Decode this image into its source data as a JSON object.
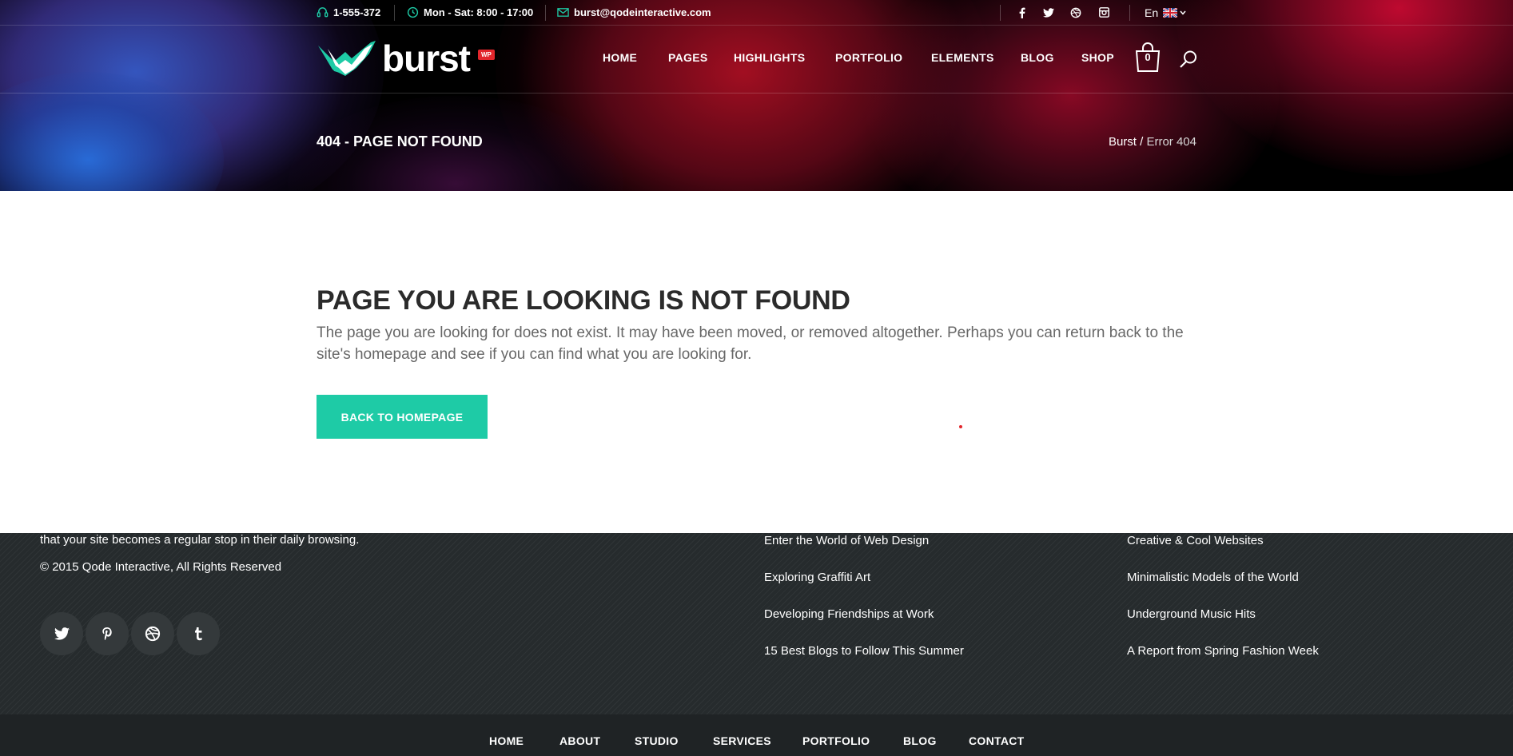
{
  "colors": {
    "accent": "#1ecba6",
    "badge": "#e2262c",
    "footer_bg": "#262b2d"
  },
  "topbar": {
    "phone": "1-555-372",
    "hours": "Mon - Sat: 8:00 - 17:00",
    "email": "burst@qodeinteractive.com",
    "language": "En",
    "social_icons": [
      "facebook-icon",
      "twitter-icon",
      "dribbble-icon",
      "instagram-icon"
    ]
  },
  "brand": {
    "name": "burst",
    "badge": "WP"
  },
  "nav": {
    "items": [
      "HOME",
      "PAGES",
      "HIGHLIGHTS",
      "PORTFOLIO",
      "ELEMENTS",
      "BLOG",
      "SHOP"
    ],
    "cart_count": "0"
  },
  "title_bar": {
    "title": "404 - PAGE NOT FOUND",
    "breadcrumb_home": "Burst",
    "breadcrumb_sep": " / ",
    "breadcrumb_current": "Error 404"
  },
  "error": {
    "heading": "PAGE YOU ARE LOOKING IS NOT FOUND",
    "text": "The page you are looking for does not exist. It may have been moved, or removed altogether. Perhaps you can return back to the site's homepage and see if you can find what you are looking for.",
    "button": "BACK TO HOMEPAGE"
  },
  "footer": {
    "about_text": "that your site becomes a regular stop in their daily browsing.",
    "copyright": "© 2015 Qode Interactive, All Rights Reserved",
    "social_icons": [
      "twitter-icon",
      "pinterest-icon",
      "dribbble-icon",
      "tumblr-icon"
    ],
    "col2_links": [
      "Enter the World of Web Design",
      "Exploring Graffiti Art",
      "Developing Friendships at Work",
      "15 Best Blogs to Follow This Summer"
    ],
    "col3_links": [
      "Creative & Cool Websites",
      "Minimalistic Models of the World",
      "Underground Music Hits",
      "A Report from Spring Fashion Week"
    ]
  },
  "bottom_nav": [
    "HOME",
    "ABOUT",
    "STUDIO",
    "SERVICES",
    "PORTFOLIO",
    "BLOG",
    "CONTACT"
  ]
}
